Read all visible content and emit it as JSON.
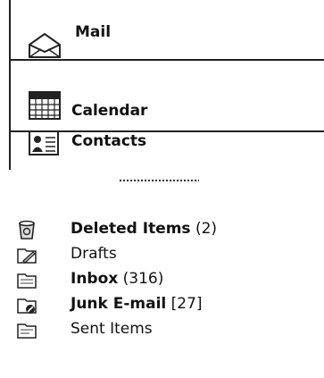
{
  "nav": {
    "mail_label": "Mail",
    "calendar_label": "Calendar",
    "contacts_label": "Contacts"
  },
  "folders": [
    {
      "name": "Deleted Items",
      "count": "(2)",
      "bold": true,
      "icon": "deleted-items-icon"
    },
    {
      "name": "Drafts",
      "count": "",
      "bold": false,
      "icon": "drafts-icon"
    },
    {
      "name": "Inbox",
      "count": "(316)",
      "bold": true,
      "icon": "inbox-icon"
    },
    {
      "name": "Junk E-mail",
      "count": "[27]",
      "bold": true,
      "icon": "junk-email-icon"
    },
    {
      "name": "Sent Items",
      "count": "",
      "bold": false,
      "icon": "sent-items-icon"
    }
  ]
}
